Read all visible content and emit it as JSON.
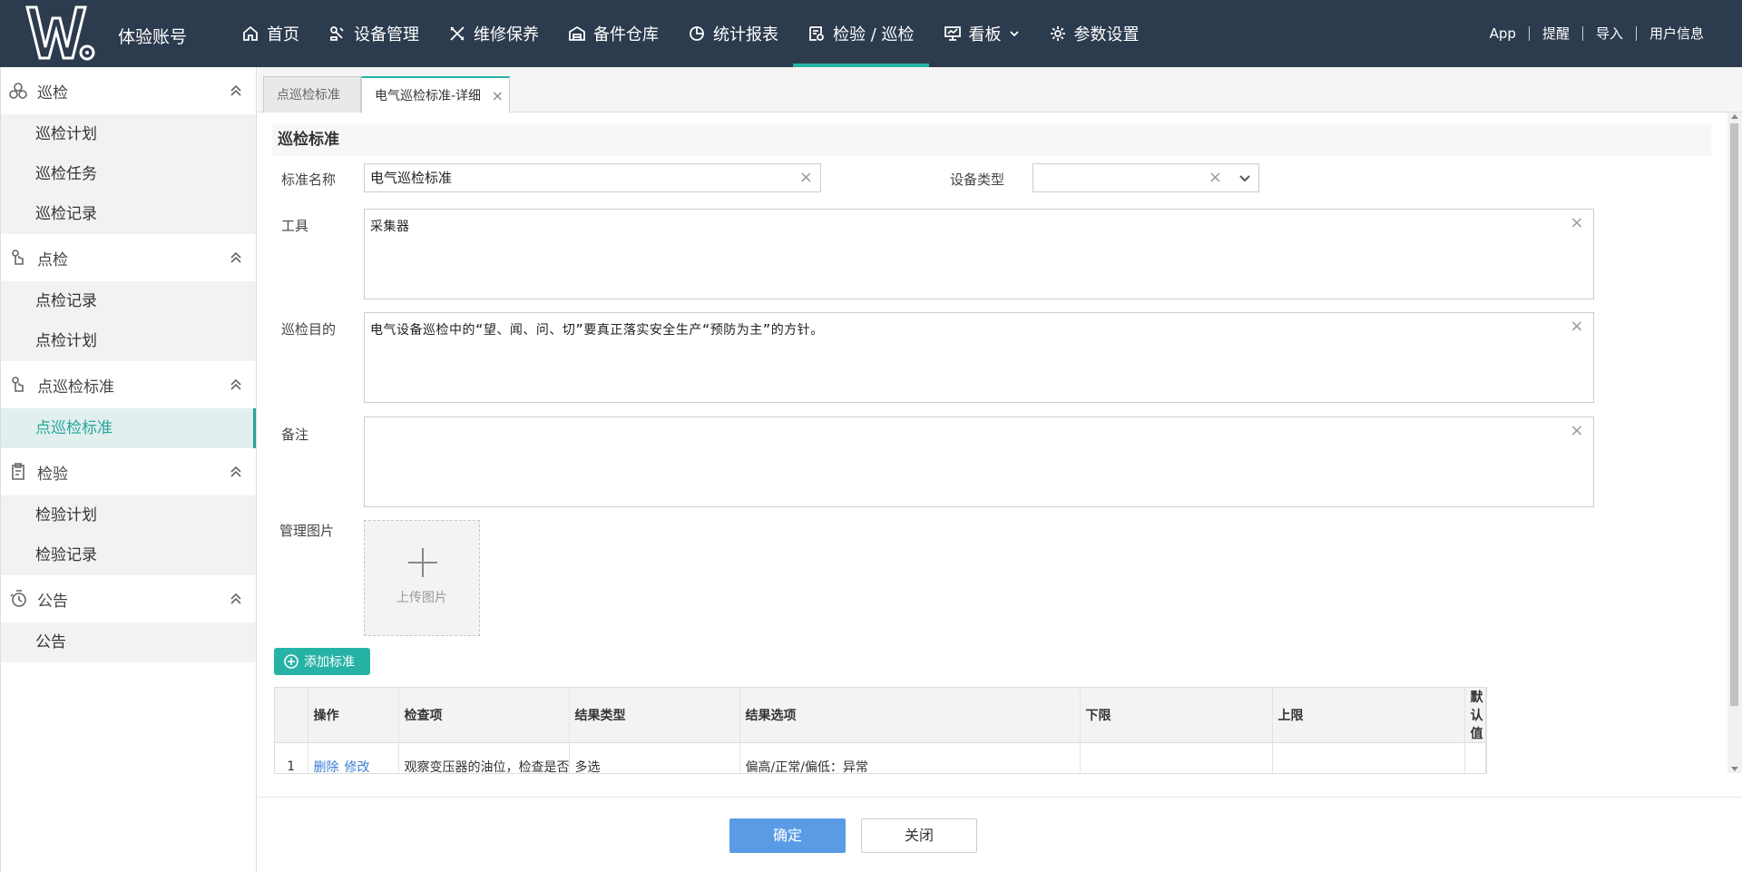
{
  "header": {
    "account_name": "体验账号",
    "nav": [
      {
        "label": "首页",
        "icon": "home-icon"
      },
      {
        "label": "设备管理",
        "icon": "device-icon"
      },
      {
        "label": "维修保养",
        "icon": "tools-icon"
      },
      {
        "label": "备件仓库",
        "icon": "warehouse-icon"
      },
      {
        "label": "统计报表",
        "icon": "chart-icon"
      },
      {
        "label": "检验 / 巡检",
        "icon": "inspection-icon",
        "active": true
      },
      {
        "label": "看板",
        "icon": "board-icon"
      },
      {
        "label": "参数设置",
        "icon": "gear-icon"
      }
    ],
    "right_links": [
      "App",
      "提醒",
      "导入",
      "用户信息"
    ],
    "accent": "#26b3a6",
    "bg": "#2c3b4e"
  },
  "sidebar": {
    "groups": [
      {
        "label": "巡检",
        "items": [
          "巡检计划",
          "巡检任务",
          "巡检记录"
        ]
      },
      {
        "label": "点检",
        "items": [
          "点检记录",
          "点检计划"
        ]
      },
      {
        "label": "点巡检标准",
        "items": [
          "点巡检标准"
        ]
      },
      {
        "label": "检验",
        "items": [
          "检验计划",
          "检验记录"
        ]
      },
      {
        "label": "公告",
        "items": [
          "公告"
        ]
      }
    ]
  },
  "tabs": [
    "点巡检标准",
    "电气巡检标准-详细"
  ],
  "form": {
    "section_title": "巡检标准",
    "name_label": "标准名称",
    "name_value": "电气巡检标准",
    "type_label": "设备类型",
    "type_value": "",
    "tool_label": "工具",
    "tool_value": "采集器",
    "purpose_label": "巡检目的",
    "purpose_value": "电气设备巡检中的“望、闻、问、切”要真正落实安全生产“预防为主”的方针。",
    "remark_label": "备注",
    "remark_value": "",
    "image_label": "管理图片",
    "upload_text": "上传图片",
    "add_button": "添加标准"
  },
  "table": {
    "columns": [
      "操作",
      "检查项",
      "结果类型",
      "结果选项",
      "下限",
      "上限",
      "默认值"
    ],
    "rows": [
      {
        "num": "1",
        "delete": "删除",
        "edit": "修改",
        "item": "观察变压器的油位，检查是否",
        "result_type": "多选",
        "options": "偏高/正常/偏低：异常",
        "lower": "",
        "upper": "",
        "default": ""
      }
    ]
  },
  "footer": {
    "ok": "确定",
    "close": "关闭"
  }
}
